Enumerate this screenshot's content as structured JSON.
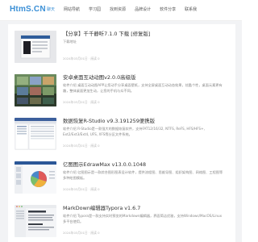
{
  "site": {
    "logo": "HtmS.CN"
  },
  "nav": [
    "聊天",
    "网站导航",
    "学习园",
    "找到资源",
    "品牌设计",
    "软件分享",
    "联系我"
  ],
  "articles": [
    {
      "title": "【分享】千千静听7.1.0 下载 [修复版]",
      "desc": "下载地址",
      "date": "2024年03月01日",
      "views": "阅读 0"
    },
    {
      "title": "安卓桌面互动动图v2.0.0高级版",
      "desc": "软件介绍 桌面互动动图APP让您动手分享桌面壁纸，支持全屏桌面互动动态效果，炫酷个性，桌面元素更有趣，整体桌面更加生动，让您的手机与众不同。",
      "date": "2024年03月01日",
      "views": "阅读 0"
    },
    {
      "title": "数据恢复R-Studio v9.3.191259便携版",
      "desc": "软件介绍 R-Studio是一款强大的数据恢复软件，支持FAT12/16/32, NTFS, ReFS, HFS/HFS+, Ext2/Ext3/Ext4, UFS, XFS等分区文件系统。",
      "date": "2024年03月01日",
      "views": "阅读 0"
    },
    {
      "title": "亿图图示EdrawMax v13.0.0.1048",
      "desc": "软件介绍 亿图图示是一款综合图形图表设计软件，提供流程图、思维导图、组织架构图、网络图、工程图等多种绘图模板。",
      "date": "2024年03月01日",
      "views": "阅读 0"
    },
    {
      "title": "MarkDown编辑器Typora v1.6.7",
      "desc": "软件介绍 Typora是一款支持实时预览的Markdown编辑器，界面简洁优雅，支持Windows/MacOS/Linux多平台使用。",
      "date": "2024年03月01日",
      "views": "阅读 0"
    }
  ]
}
